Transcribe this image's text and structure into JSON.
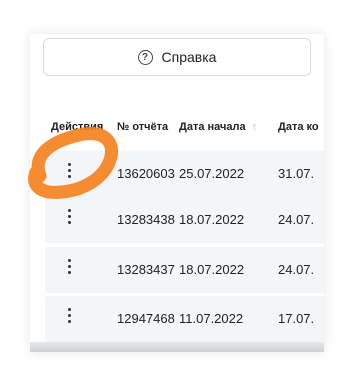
{
  "help_button": {
    "label": "Справка",
    "icon": "question-circle-icon",
    "glyph": "?"
  },
  "table": {
    "columns": [
      {
        "key": "actions",
        "label": "Действия"
      },
      {
        "key": "report_no",
        "label": "№ отчёта"
      },
      {
        "key": "start_date",
        "label": "Дата начала",
        "sort_icon": "↑"
      },
      {
        "key": "end_date",
        "label": "Дата ко"
      }
    ],
    "rows": [
      {
        "report_no": "13620603",
        "start_date": "25.07.2022",
        "end_date": "31.07."
      },
      {
        "report_no": "13283438",
        "start_date": "18.07.2022",
        "end_date": "24.07."
      },
      {
        "report_no": "13283437",
        "start_date": "18.07.2022",
        "end_date": "24.07."
      },
      {
        "report_no": "12947468",
        "start_date": "11.07.2022",
        "end_date": "17.07."
      }
    ]
  },
  "annotation_color": "#f58220"
}
